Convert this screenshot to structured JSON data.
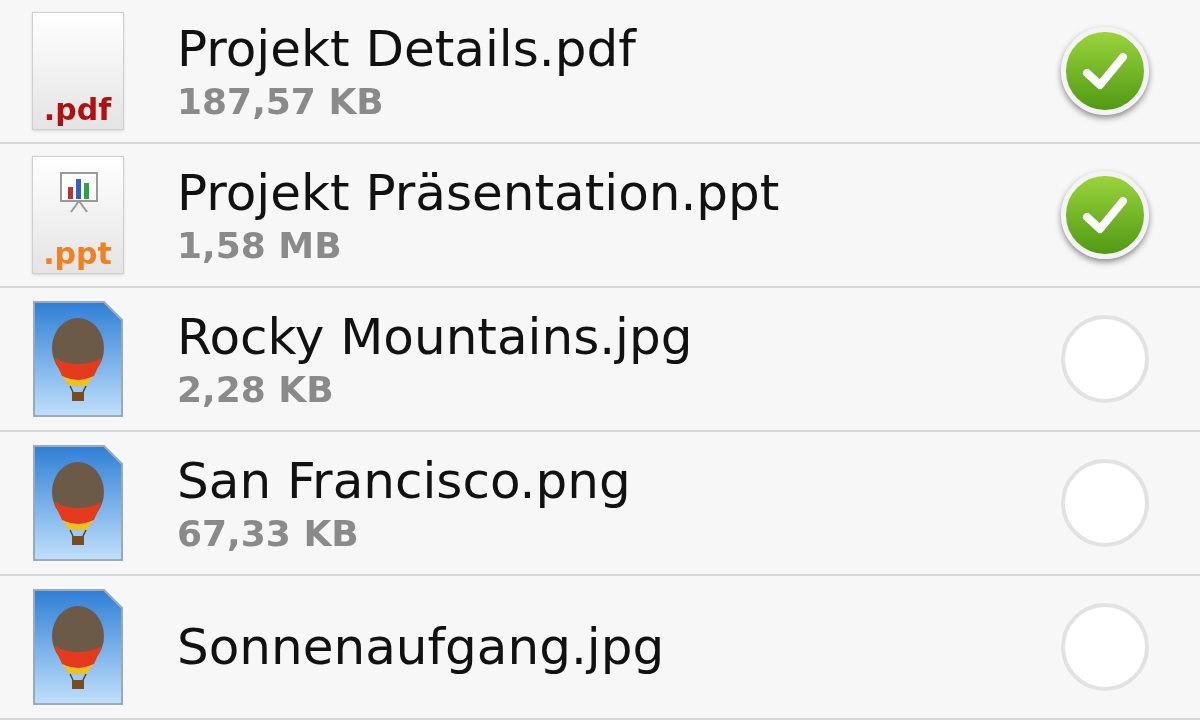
{
  "files": [
    {
      "name": "Projekt Details.pdf",
      "size": "187,57 KB",
      "kind": "pdf",
      "badge": ".pdf",
      "selected": true
    },
    {
      "name": "Projekt Präsentation.ppt",
      "size": "1,58 MB",
      "kind": "ppt",
      "badge": ".ppt",
      "selected": true
    },
    {
      "name": "Rocky Mountains.jpg",
      "size": "2,28 KB",
      "kind": "image",
      "selected": false
    },
    {
      "name": "San Francisco.png",
      "size": "67,33 KB",
      "kind": "image",
      "selected": false
    },
    {
      "name": "Sonnenaufgang.jpg",
      "kind": "image",
      "selected": false
    }
  ]
}
